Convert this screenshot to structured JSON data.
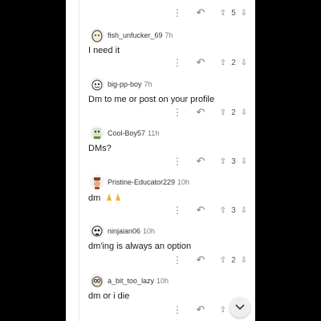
{
  "thread": {
    "top_action": {
      "vote_count": "5"
    },
    "comments": [
      {
        "username": "fish_unfucker_69",
        "time": "7h",
        "text": "I need it",
        "vote_count": "2",
        "avatar": "egg-avatar-icon"
      },
      {
        "username": "big-pp-boy",
        "time": "7h",
        "text": "Dm to me or post on your profile",
        "vote_count": "2",
        "avatar": "goofy-face-avatar-icon"
      },
      {
        "username": "Cool-Boy57",
        "time": "11h",
        "text": "DMs?",
        "vote_count": "3",
        "avatar": "pixel-character-avatar-icon"
      },
      {
        "username": "Pristine-Educator229",
        "time": "10h",
        "text": "dm",
        "vote_count": "3",
        "avatar": "hat-character-avatar-icon"
      },
      {
        "username": "ninjaian06",
        "time": "10h",
        "text": "dm'ing is always an option",
        "vote_count": "2",
        "avatar": "skull-avatar-icon"
      },
      {
        "username": "a_bit_too_lazy",
        "time": "10h",
        "text": "dm or i die",
        "vote_count": "",
        "avatar": "glasses-avatar-icon"
      }
    ],
    "emoji_after_dm": "praying-hands-emoji"
  },
  "icons": {
    "more": "more-options-icon",
    "reply": "reply-icon",
    "upvote": "upvote-icon",
    "downvote": "downvote-icon",
    "scroll": "chevron-down-icon"
  },
  "colors": {
    "background": "#ffffff",
    "letterbox": "#000000",
    "muted": "#7c7c7c"
  }
}
